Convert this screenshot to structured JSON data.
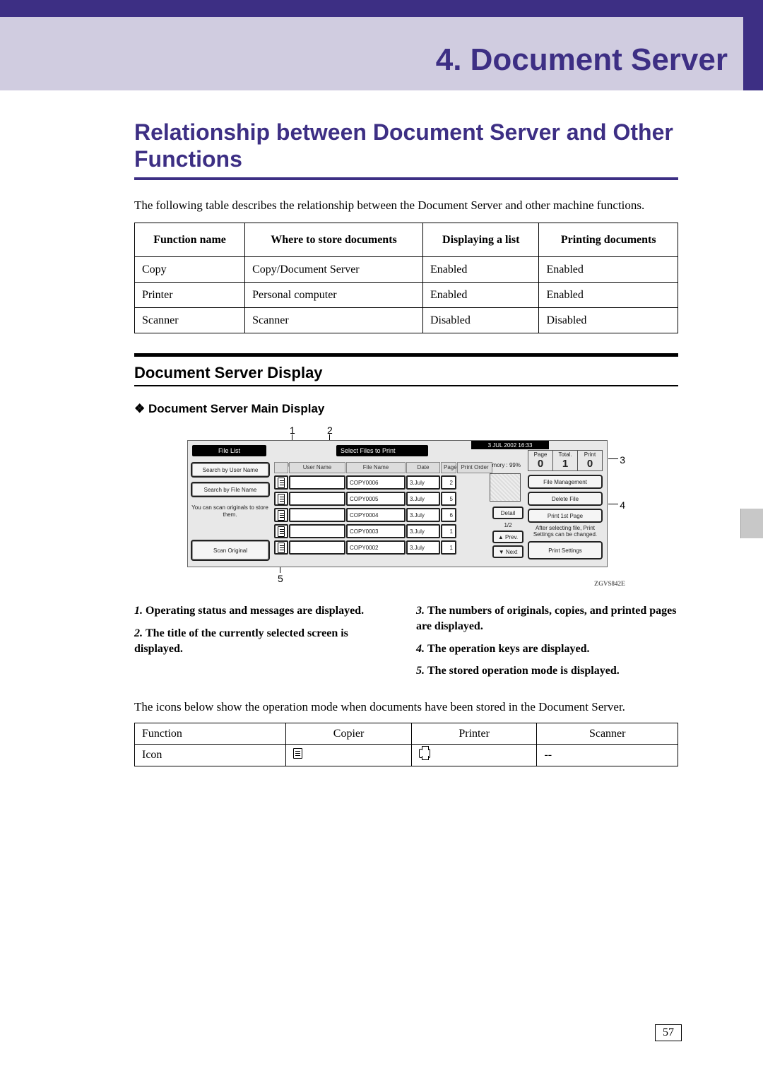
{
  "chapter": {
    "title": "4. Document Server"
  },
  "section": {
    "title": "Relationship between Document Server and Other Functions",
    "intro": "The following table describes the relationship between the Document Server and other machine functions."
  },
  "rel_table": {
    "headers": [
      "Function name",
      "Where to store documents",
      "Displaying a list",
      "Printing documents"
    ],
    "rows": [
      [
        "Copy",
        "Copy/Document Server",
        "Enabled",
        "Enabled"
      ],
      [
        "Printer",
        "Personal computer",
        "Enabled",
        "Enabled"
      ],
      [
        "Scanner",
        "Scanner",
        "Disabled",
        "Disabled"
      ]
    ]
  },
  "subsection": {
    "title": "Document Server Display"
  },
  "diamond": {
    "label": "❖ Document Server Main Display"
  },
  "screenshot": {
    "callouts_top": [
      "1",
      "2"
    ],
    "callouts_right": [
      "3",
      "4"
    ],
    "callout_bottom": "5",
    "code": "ZGVS842E",
    "titlebar": "File List",
    "select_title": "Select Files to Print",
    "datebar": "3  JUL   2002 16:33",
    "counter": [
      {
        "label": "Page",
        "val": "0"
      },
      {
        "label": "Total.",
        "val": "1"
      },
      {
        "label": "Print",
        "val": "0"
      }
    ],
    "memory": "Memory :  99%",
    "subheader_info": "Select files to print",
    "left_buttons": [
      "Search by User Name",
      "Search by File Name"
    ],
    "scan_button": "Scan Original",
    "side_text": "You can scan originals to store them.",
    "columns": [
      "User Name",
      "File Name",
      "Date",
      "Page",
      "Print Order"
    ],
    "files": [
      {
        "name": "COPY0006",
        "date": "3.July",
        "page": "2"
      },
      {
        "name": "COPY0005",
        "date": "3.July",
        "page": "5"
      },
      {
        "name": "COPY0004",
        "date": "3.July",
        "page": "6"
      },
      {
        "name": "COPY0003",
        "date": "3.July",
        "page": "1"
      },
      {
        "name": "COPY0002",
        "date": "3.July",
        "page": "1"
      }
    ],
    "detail_btn": "Detail",
    "page_indicator": "1/2",
    "prev": "▲ Prev.",
    "next": "▼ Next",
    "right_buttons_top": [
      "File Management",
      "Delete File",
      "Print 1st Page"
    ],
    "right_text": "After selecting file, Print Settings can be changed.",
    "right_button_bottom": "Print Settings"
  },
  "legend": {
    "left": [
      {
        "n": "1.",
        "t": "Operating status and messages are displayed."
      },
      {
        "n": "2.",
        "t": "The title of the currently selected screen is displayed."
      }
    ],
    "right": [
      {
        "n": "3.",
        "t": "The numbers of originals, copies, and printed pages are displayed."
      },
      {
        "n": "4.",
        "t": "The operation keys are displayed."
      },
      {
        "n": "5.",
        "t": "The stored operation mode is displayed."
      }
    ]
  },
  "icons_intro": "The icons below show the operation mode when documents have been stored in the Document Server.",
  "icons_table": {
    "headers": [
      "Function",
      "Copier",
      "Printer",
      "Scanner"
    ],
    "row": [
      "Icon",
      "",
      "",
      "--"
    ]
  },
  "page_number": "57"
}
